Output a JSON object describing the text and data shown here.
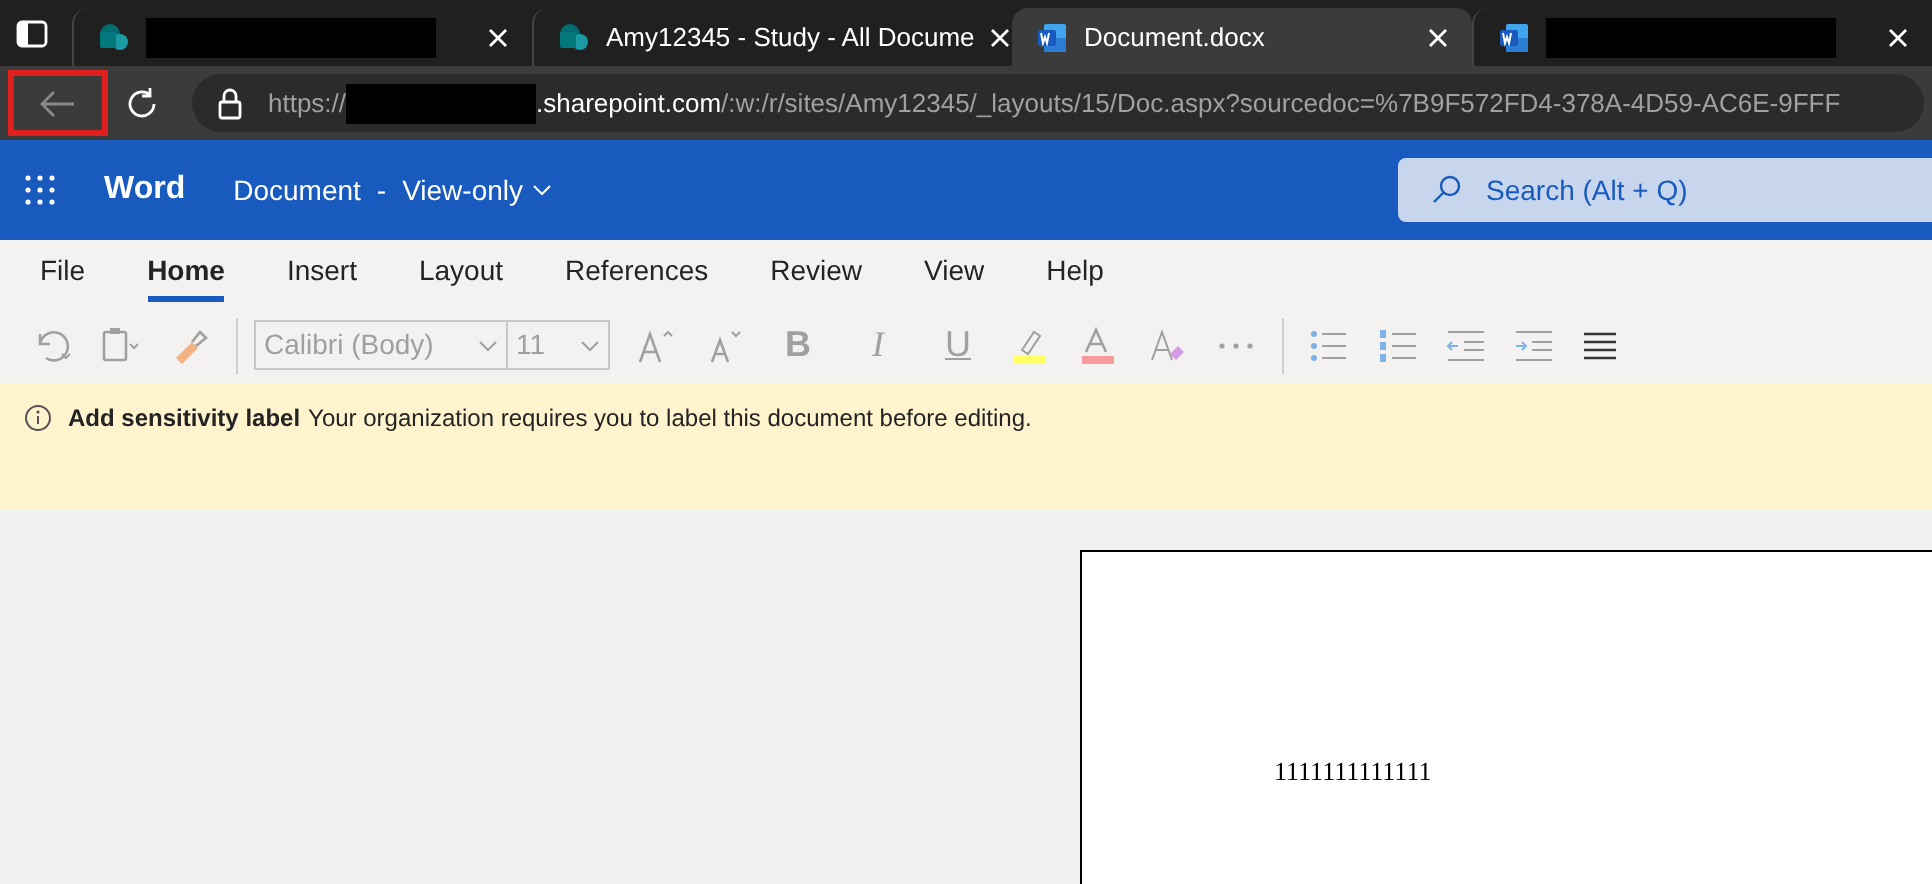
{
  "browser_tabs": [
    {
      "kind": "sharepoint",
      "redacted": true,
      "selected": false
    },
    {
      "kind": "sharepoint",
      "title": "Amy12345 - Study - All Docume",
      "redacted": false,
      "selected": false
    },
    {
      "kind": "word",
      "title": "Document.docx",
      "redacted": false,
      "selected": true
    },
    {
      "kind": "word",
      "redacted": true,
      "selected": false
    }
  ],
  "address_bar": {
    "scheme": "https://",
    "domain": ".sharepoint.com",
    "path": "/:w:/r/sites/Amy12345/_layouts/15/Doc.aspx?sourcedoc=%7B9F572FD4-378A-4D59-AC6E-9FFF",
    "back_highlighted": true
  },
  "app_header": {
    "app_name": "Word",
    "document_name": "Document",
    "separator": "-",
    "mode": "View-only",
    "search_placeholder": "Search (Alt + Q)"
  },
  "ribbon_tabs": [
    {
      "label": "File",
      "selected": false
    },
    {
      "label": "Home",
      "selected": true
    },
    {
      "label": "Insert",
      "selected": false
    },
    {
      "label": "Layout",
      "selected": false
    },
    {
      "label": "References",
      "selected": false
    },
    {
      "label": "Review",
      "selected": false
    },
    {
      "label": "View",
      "selected": false
    },
    {
      "label": "Help",
      "selected": false
    }
  ],
  "toolbar": {
    "font_name": "Calibri (Body)",
    "font_size": "11",
    "bold_glyph": "B",
    "italic_glyph": "I",
    "underline_glyph": "U"
  },
  "banner": {
    "title": "Add sensitivity label",
    "message": "Your organization requires you to label this document before editing."
  },
  "document": {
    "text": "1111111111111"
  }
}
